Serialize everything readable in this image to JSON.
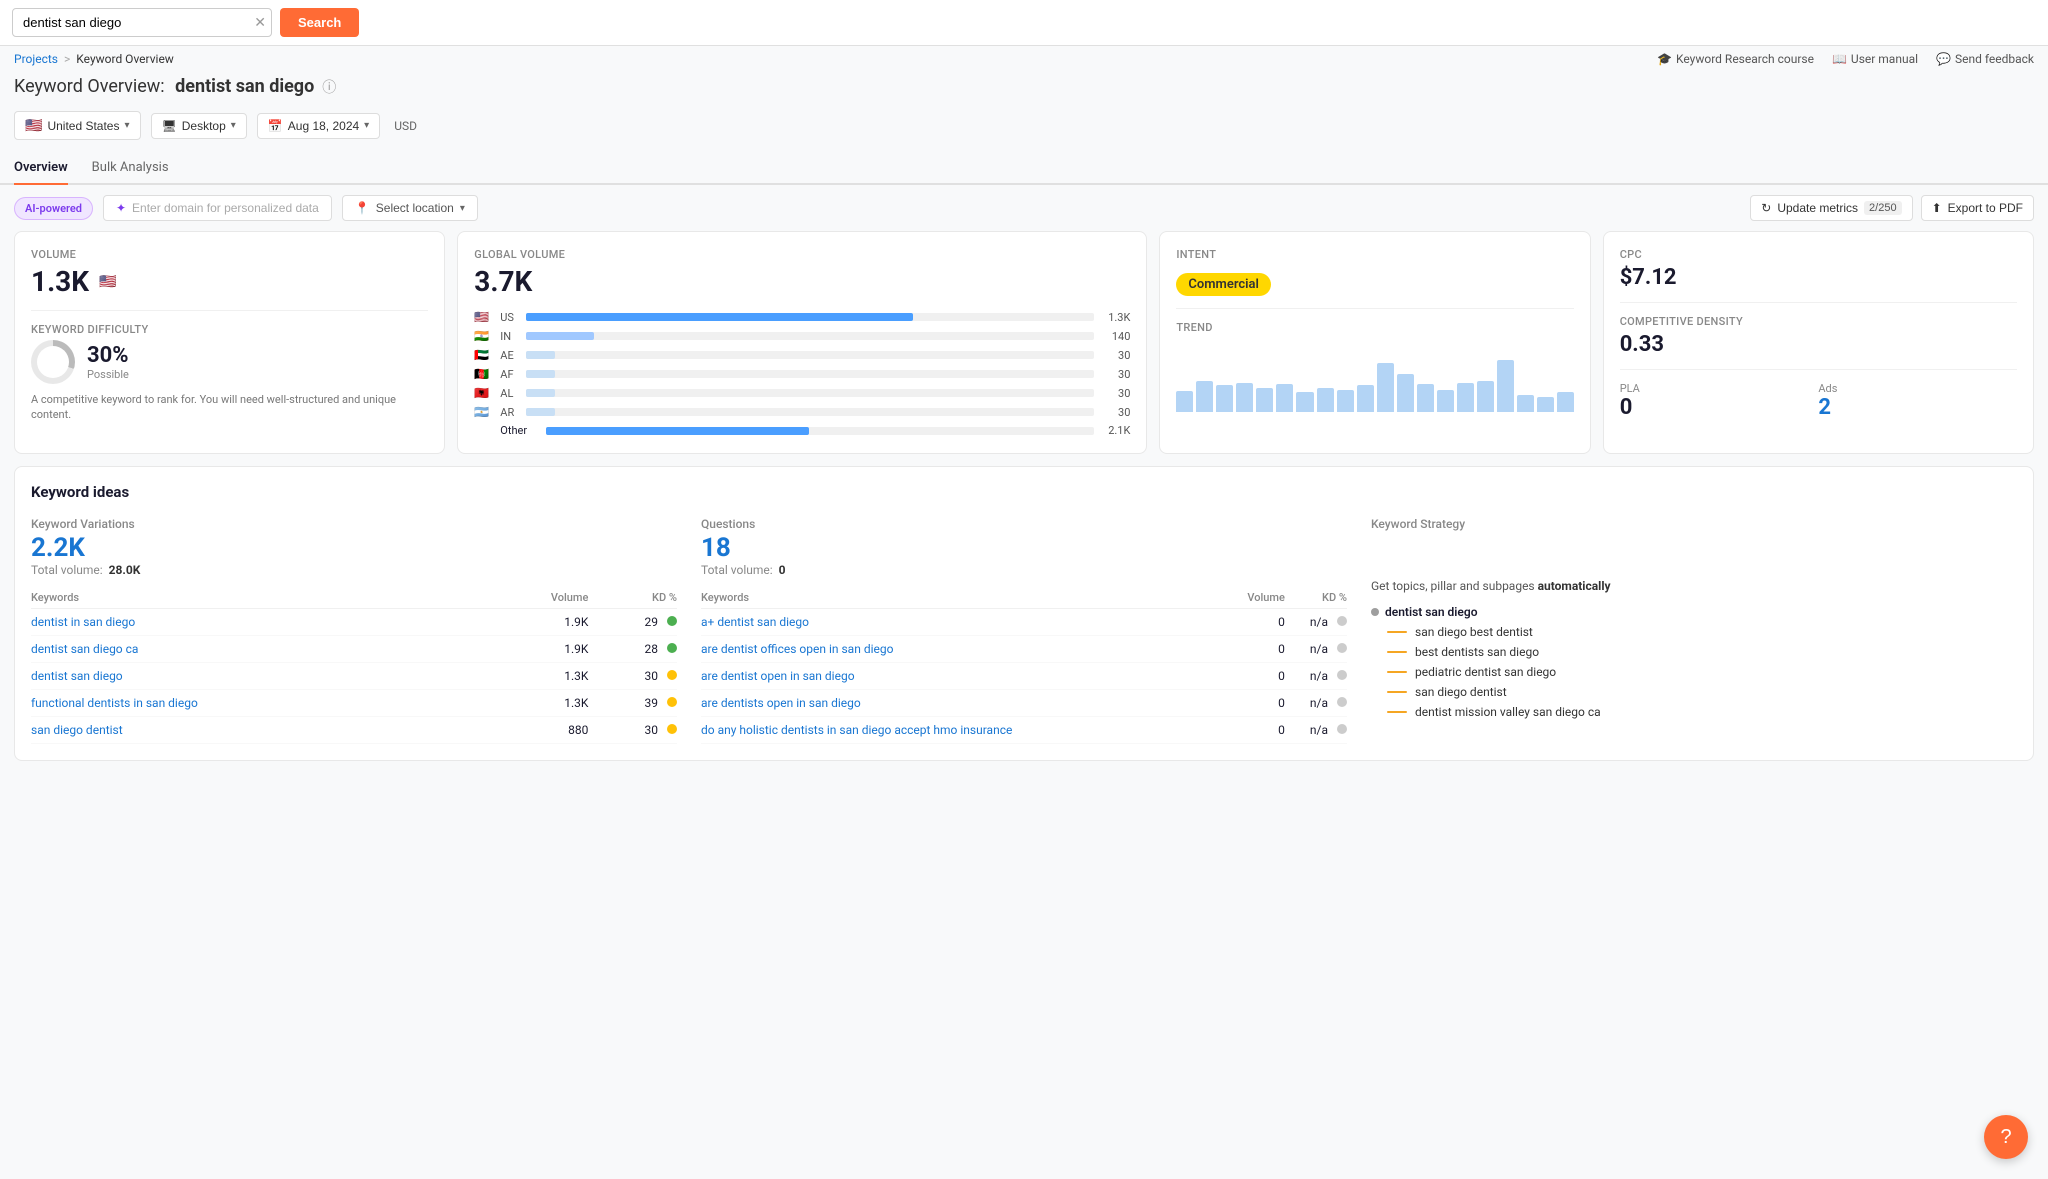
{
  "search": {
    "query": "dentist san diego",
    "button_label": "Search",
    "clear_title": "Clear"
  },
  "breadcrumb": {
    "parent": "Projects",
    "separator": ">",
    "current": "Keyword Overview"
  },
  "page_title": {
    "prefix": "Keyword Overview:",
    "keyword": "dentist san diego"
  },
  "top_links": {
    "course": "Keyword Research course",
    "manual": "User manual",
    "feedback": "Send feedback"
  },
  "filters": {
    "country": "United States",
    "device": "Desktop",
    "date": "Aug 18, 2024",
    "currency": "USD"
  },
  "tabs": [
    {
      "id": "overview",
      "label": "Overview",
      "active": true
    },
    {
      "id": "bulk",
      "label": "Bulk Analysis",
      "active": false
    }
  ],
  "toolbar": {
    "ai_badge": "AI-powered",
    "domain_placeholder": "Enter domain for personalized data",
    "location_placeholder": "Select location",
    "update_label": "Update metrics",
    "update_counter": "2/250",
    "export_label": "Export to PDF"
  },
  "volume_card": {
    "label": "Volume",
    "value": "1.3K"
  },
  "global_volume": {
    "label": "Global Volume",
    "value": "3.7K",
    "rows": [
      {
        "flag": "🇺🇸",
        "code": "US",
        "bar_pct": 68,
        "num": "1.3K"
      },
      {
        "flag": "🇮🇳",
        "code": "IN",
        "bar_pct": 12,
        "num": "140"
      },
      {
        "flag": "🇦🇪",
        "code": "AE",
        "bar_pct": 5,
        "num": "30"
      },
      {
        "flag": "🇦🇫",
        "code": "AF",
        "bar_pct": 5,
        "num": "30"
      },
      {
        "flag": "🇦🇱",
        "code": "AL",
        "bar_pct": 5,
        "num": "30"
      },
      {
        "flag": "🇦🇷",
        "code": "AR",
        "bar_pct": 5,
        "num": "30"
      },
      {
        "flag": null,
        "code": "Other",
        "bar_pct": 48,
        "num": "2.1K"
      }
    ]
  },
  "intent_card": {
    "label": "Intent",
    "value": "Commercial"
  },
  "trend_card": {
    "label": "Trend",
    "bars": [
      30,
      45,
      38,
      42,
      35,
      40,
      28,
      35,
      32,
      38,
      55,
      48,
      38,
      32,
      42,
      45,
      60,
      25,
      30,
      28
    ]
  },
  "cpc_card": {
    "cpc_label": "CPC",
    "cpc_value": "$7.12",
    "density_label": "Competitive Density",
    "density_value": "0.33",
    "pla_label": "PLA",
    "pla_value": "0",
    "ads_label": "Ads",
    "ads_value": "2"
  },
  "kd_card": {
    "label": "Keyword Difficulty",
    "value": "30%",
    "sublabel": "Possible",
    "description": "A competitive keyword to rank for. You will need well-structured and unique content."
  },
  "keyword_ideas": {
    "title": "Keyword ideas",
    "variations": {
      "section": "Keyword Variations",
      "count": "2.2K",
      "total_label": "Total volume:",
      "total_value": "28.0K",
      "col_keywords": "Keywords",
      "col_volume": "Volume",
      "col_kd": "KD %",
      "rows": [
        {
          "kw": "dentist in san diego",
          "vol": "1.9K",
          "kd": 29,
          "dot": "green"
        },
        {
          "kw": "dentist san diego ca",
          "vol": "1.9K",
          "kd": 28,
          "dot": "green"
        },
        {
          "kw": "dentist san diego",
          "vol": "1.3K",
          "kd": 30,
          "dot": "yellow"
        },
        {
          "kw": "functional dentists in san diego",
          "vol": "1.3K",
          "kd": 39,
          "dot": "yellow"
        },
        {
          "kw": "san diego dentist",
          "vol": "880",
          "kd": 30,
          "dot": "yellow"
        }
      ]
    },
    "questions": {
      "section": "Questions",
      "count": "18",
      "total_label": "Total volume:",
      "total_value": "0",
      "col_keywords": "Keywords",
      "col_volume": "Volume",
      "col_kd": "KD %",
      "rows": [
        {
          "kw": "a+ dentist san diego",
          "vol": "0",
          "kd": "n/a",
          "dot": "gray"
        },
        {
          "kw": "are dentist offices open in san diego",
          "vol": "0",
          "kd": "n/a",
          "dot": "gray"
        },
        {
          "kw": "are dentist open in san diego",
          "vol": "0",
          "kd": "n/a",
          "dot": "gray"
        },
        {
          "kw": "are dentists open in san diego",
          "vol": "0",
          "kd": "n/a",
          "dot": "gray"
        },
        {
          "kw": "do any holistic dentists in san diego accept hmo insurance",
          "vol": "0",
          "kd": "n/a",
          "dot": "gray"
        }
      ]
    },
    "strategy": {
      "section": "Keyword Strategy",
      "description_before": "Get topics, pillar and subpages ",
      "description_bold": "automatically",
      "root": "dentist san diego",
      "items": [
        {
          "label": "san diego best dentist",
          "color": "#f5a623"
        },
        {
          "label": "best dentists san diego",
          "color": "#f5a623"
        },
        {
          "label": "pediatric dentist san diego",
          "color": "#f5a623"
        },
        {
          "label": "san diego dentist",
          "color": "#f5a623"
        },
        {
          "label": "dentist mission valley san diego ca",
          "color": "#f5a623"
        }
      ]
    }
  }
}
